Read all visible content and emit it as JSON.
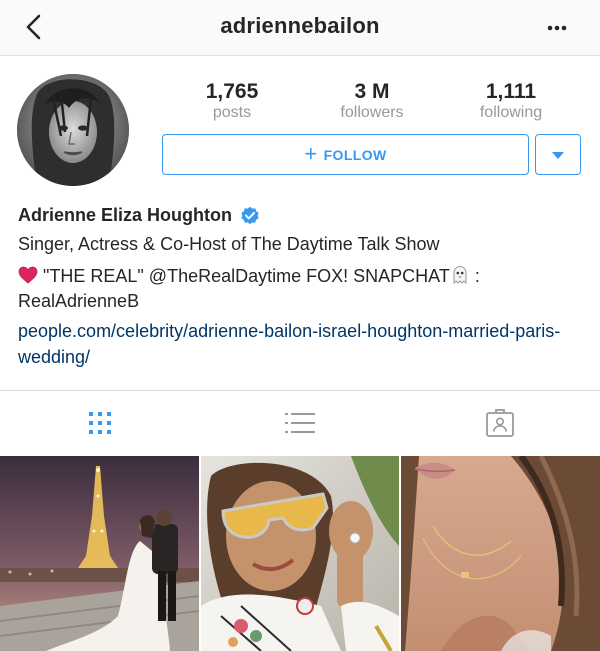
{
  "header": {
    "username": "adriennebailon",
    "back_icon": "chevron-left-icon",
    "more_icon": "ellipsis-icon"
  },
  "stats": {
    "posts": {
      "value": "1,765",
      "label": "posts"
    },
    "followers": {
      "value": "3 M",
      "label": "followers"
    },
    "following": {
      "value": "1,111",
      "label": "following"
    }
  },
  "actions": {
    "follow_label": "FOLLOW",
    "follow_icon": "plus-icon",
    "dropdown_icon": "caret-down-icon"
  },
  "profile": {
    "full_name": "Adrienne Eliza Houghton",
    "verified": true,
    "bio_line1": "Singer, Actress & Co-Host of The Daytime Talk Show",
    "bio_line2_part1": " \"THE REAL\" @TheRealDaytime FOX! SNAPCHAT",
    "bio_line2_part2": " : RealAdrienneB",
    "link": "people.com/celebrity/adrienne-bailon-israel-houghton-married-paris-wedding/"
  },
  "tabs": [
    {
      "name": "grid-view",
      "icon": "grid-icon",
      "active": true
    },
    {
      "name": "list-view",
      "icon": "list-icon",
      "active": false
    },
    {
      "name": "tagged",
      "icon": "tagged-person-icon",
      "active": false
    }
  ],
  "colors": {
    "accent": "#3897f0",
    "link": "#003569",
    "muted": "#999999",
    "text": "#262626"
  }
}
